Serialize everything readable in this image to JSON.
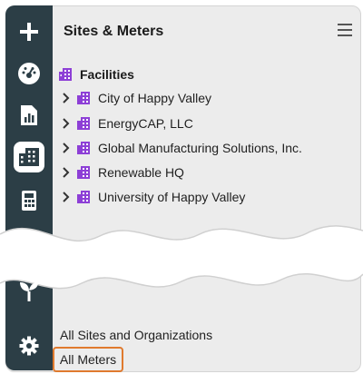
{
  "header": {
    "title": "Sites & Meters"
  },
  "tree": {
    "root_label": "Facilities",
    "items": [
      {
        "label": "City of Happy Valley"
      },
      {
        "label": "EnergyCAP, LLC"
      },
      {
        "label": "Global Manufacturing Solutions, Inc."
      },
      {
        "label": "Renewable HQ"
      },
      {
        "label": "University of Happy Valley"
      }
    ]
  },
  "bottom": {
    "all_sites_label": "All Sites and Organizations",
    "all_meters_label": "All Meters"
  },
  "colors": {
    "rail": "#2c3e46",
    "panel": "#ececec",
    "building_icon": "#8d3fd6",
    "highlight": "#e07a2e"
  },
  "icons": {
    "rail": [
      "plus-icon",
      "dashboard-icon",
      "report-icon",
      "building-icon",
      "calculator-icon",
      "sprout-icon",
      "gear-icon"
    ]
  }
}
